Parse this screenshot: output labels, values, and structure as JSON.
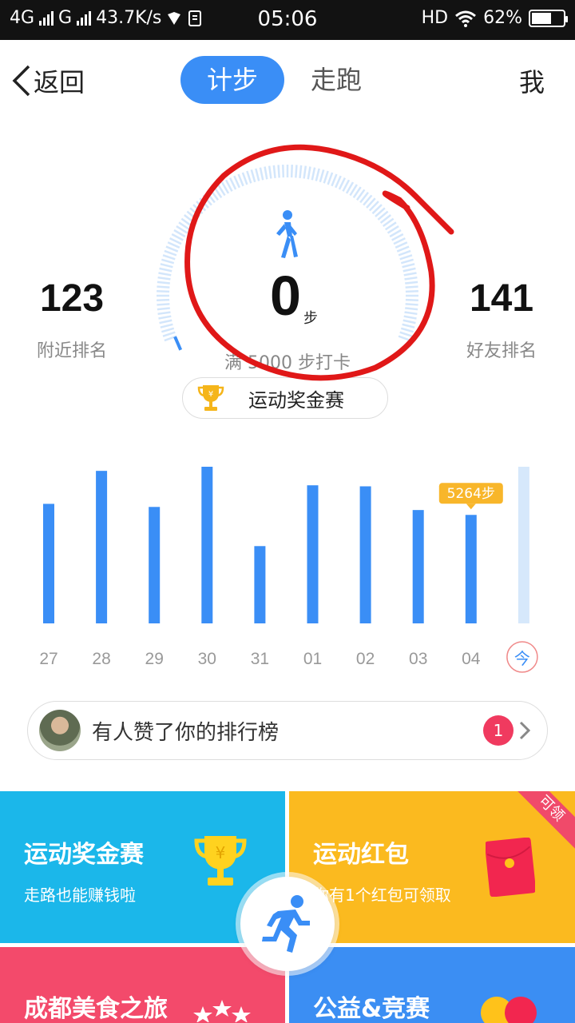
{
  "status_bar": {
    "network": "4G",
    "network2": "G",
    "speed": "43.7K/s",
    "time": "05:06",
    "hd": "HD",
    "battery": "62%",
    "battery_level": 0.62
  },
  "header": {
    "back_label": "返回",
    "tabs": [
      {
        "label": "计步",
        "active": true
      },
      {
        "label": "走跑",
        "active": false
      }
    ],
    "me_label": "我"
  },
  "progress": {
    "steps": "0",
    "unit": "步",
    "goal_text": "满 5000 步打卡",
    "fraction": 0.0
  },
  "rank_nearby": {
    "value": "123",
    "label": "附近排名"
  },
  "rank_friends": {
    "value": "141",
    "label": "好友排名"
  },
  "prize_pill": {
    "label": "运动奖金赛"
  },
  "chart_data": {
    "type": "bar",
    "categories": [
      "27",
      "28",
      "29",
      "30",
      "31",
      "01",
      "02",
      "03",
      "04",
      "今"
    ],
    "values": [
      5800,
      7400,
      5650,
      7600,
      3750,
      6700,
      6650,
      5500,
      5264,
      7600
    ],
    "highlight_label": "5264步",
    "highlight_index": 8,
    "colors": {
      "bar": "#3a8ef6",
      "today": "#d6e8fb",
      "tooltip": "#f8b62a",
      "today_circle": "#f08a8a"
    }
  },
  "like_row": {
    "text": "有人赞了你的排行榜",
    "count": "1"
  },
  "tiles": {
    "prize": {
      "title": "运动奖金赛",
      "subtitle": "走路也能赚钱啦"
    },
    "redpack": {
      "title": "运动红包",
      "subtitle": "你有1个红包可领取",
      "ribbon": "可领"
    },
    "food": {
      "title": "成都美食之旅"
    },
    "charity": {
      "title": "公益&竞赛"
    }
  },
  "icons": [
    "back-chevron-icon",
    "walker-icon",
    "trophy-icon",
    "chevron-right-icon",
    "runner-icon",
    "red-envelope-icon",
    "wifi-icon"
  ]
}
